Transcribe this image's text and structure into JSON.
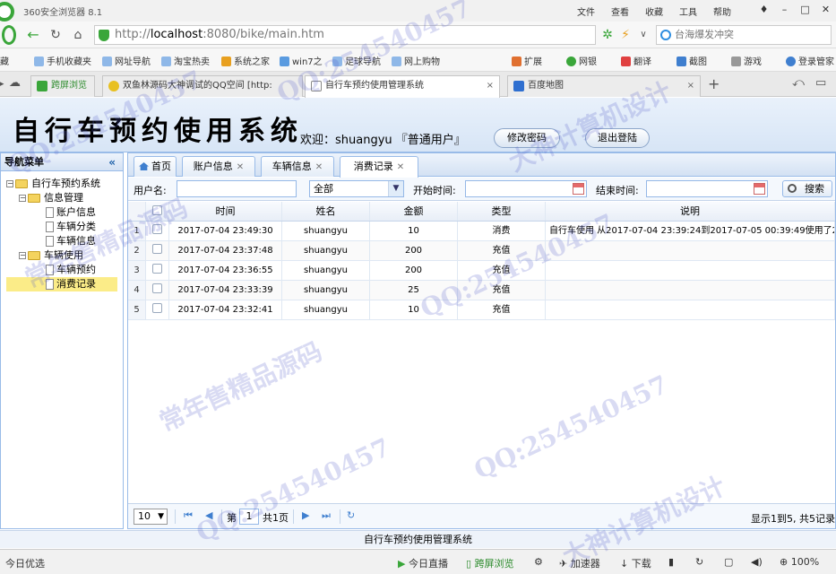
{
  "browser": {
    "title": "360安全浏览器 8.1",
    "menus": [
      "文件",
      "查看",
      "收藏",
      "工具",
      "帮助"
    ],
    "url_scheme": "http://",
    "url_host": "localhost",
    "url_rest": ":8080/bike/main.htm",
    "search_text": "台海爆发冲突",
    "favorites": [
      "藏",
      "手机收藏夹",
      "网址导航",
      "淘宝热卖",
      "系统之家",
      "win7之",
      "足球导航",
      "网上购物"
    ],
    "toolbar_items": [
      "扩展",
      "网银",
      "翻译",
      "截图",
      "游戏",
      "登录管家"
    ],
    "tabs": [
      {
        "label": "跨屏浏览",
        "icon": "green",
        "active": false
      },
      {
        "label": "双鱼林源码大神调试的QQ空间 [http:",
        "icon": "yellow",
        "active": false
      },
      {
        "label": "自行车预约使用管理系统",
        "icon": "page",
        "active": true
      },
      {
        "label": "百度地图",
        "icon": "blue",
        "active": false
      }
    ]
  },
  "header": {
    "system_title": "自行车预约使用系统",
    "welcome": "欢迎：shuangyu 『普通用户』",
    "change_password": "修改密码",
    "logout": "退出登陆"
  },
  "nav": {
    "title": "导航菜单",
    "collapse": "«",
    "tree": [
      {
        "label": "自行车预约系统",
        "level": 0,
        "type": "folder"
      },
      {
        "label": "信息管理",
        "level": 1,
        "type": "folder"
      },
      {
        "label": "账户信息",
        "level": 2,
        "type": "leaf"
      },
      {
        "label": "车辆分类",
        "level": 2,
        "type": "leaf"
      },
      {
        "label": "车辆信息",
        "level": 2,
        "type": "leaf"
      },
      {
        "label": "车辆使用",
        "level": 1,
        "type": "folder"
      },
      {
        "label": "车辆预约",
        "level": 2,
        "type": "leaf"
      },
      {
        "label": "消费记录",
        "level": 2,
        "type": "leaf",
        "selected": true
      }
    ]
  },
  "main": {
    "tabs": [
      {
        "label": "首页",
        "closable": false
      },
      {
        "label": "账户信息",
        "closable": true
      },
      {
        "label": "车辆信息",
        "closable": true
      },
      {
        "label": "消费记录",
        "closable": true,
        "active": true
      }
    ],
    "filter": {
      "username_label": "用户名:",
      "username_value": "",
      "type_value": "全部",
      "start_label": "开始时间:",
      "end_label": "结束时间:",
      "search_button": "搜索"
    },
    "columns": [
      "时间",
      "姓名",
      "金额",
      "类型",
      "说明"
    ],
    "rows": [
      {
        "n": "1",
        "time": "2017-07-04 23:49:30",
        "name": "shuangyu",
        "amount": "10",
        "type": "消费",
        "desc": "自行车使用 从2017-07-04 23:39:24到2017-07-05 00:39:49使用了2"
      },
      {
        "n": "2",
        "time": "2017-07-04 23:37:48",
        "name": "shuangyu",
        "amount": "200",
        "type": "充值",
        "desc": ""
      },
      {
        "n": "3",
        "time": "2017-07-04 23:36:55",
        "name": "shuangyu",
        "amount": "200",
        "type": "充值",
        "desc": ""
      },
      {
        "n": "4",
        "time": "2017-07-04 23:33:39",
        "name": "shuangyu",
        "amount": "25",
        "type": "充值",
        "desc": ""
      },
      {
        "n": "5",
        "time": "2017-07-04 23:32:41",
        "name": "shuangyu",
        "amount": "10",
        "type": "充值",
        "desc": ""
      }
    ],
    "pager": {
      "page_size": "10",
      "page_prefix": "第",
      "page_value": "1",
      "page_total": "共1页",
      "info": "显示1到5, 共5记录"
    }
  },
  "footer": "自行车预约使用管理系统",
  "statusbar": {
    "left": "今日优选",
    "items": [
      "今日直播",
      "跨屏浏览",
      "加速器",
      "下载",
      "100%"
    ]
  },
  "watermarks": [
    "QQ:254540457",
    "大神计算机设计",
    "常年售精品源码"
  ]
}
